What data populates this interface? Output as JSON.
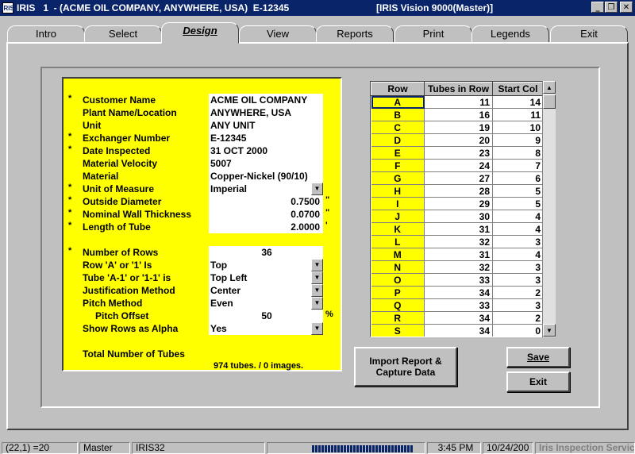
{
  "window": {
    "app_label": "IRIS",
    "title": "IRIS   1  - (ACME OIL COMPANY, ANYWHERE, USA)  E-12345",
    "title_right": "[IRIS Vision 9000(Master)]",
    "minimize": "_",
    "restore": "❐",
    "close": "✕"
  },
  "tabs": [
    "Intro",
    "Select",
    "Design",
    "View",
    "Reports",
    "Print",
    "Legends",
    "Exit"
  ],
  "active_tab": "Design",
  "form": {
    "fields": [
      {
        "required": true,
        "label": "Customer Name",
        "value": "ACME OIL COMPANY"
      },
      {
        "required": false,
        "label": "Plant Name/Location",
        "value": "ANYWHERE, USA"
      },
      {
        "required": false,
        "label": "Unit",
        "value": "ANY UNIT"
      },
      {
        "required": true,
        "label": "Exchanger Number",
        "value": "E-12345"
      },
      {
        "required": true,
        "label": "Date Inspected",
        "value": "31 OCT 2000"
      },
      {
        "required": false,
        "label": "Material Velocity",
        "value": "5007"
      },
      {
        "required": false,
        "label": "Material",
        "value": "Copper-Nickel (90/10)"
      },
      {
        "required": true,
        "label": "Unit of Measure",
        "value": "Imperial",
        "dropdown": true
      },
      {
        "required": true,
        "label": "Outside Diameter",
        "value": "0.7500",
        "unit": "\"",
        "numeric": true
      },
      {
        "required": true,
        "label": "Nominal Wall Thickness",
        "value": "0.0700",
        "unit": "\"",
        "numeric": true
      },
      {
        "required": true,
        "label": "Length of Tube",
        "value": "2.0000",
        "unit": "'",
        "numeric": true
      }
    ],
    "fields2": [
      {
        "required": true,
        "label": "Number of Rows",
        "value": "36",
        "center": true
      },
      {
        "required": false,
        "label": "Row 'A' or '1'  Is",
        "value": "Top",
        "dropdown": true
      },
      {
        "required": false,
        "label": "Tube 'A-1' or '1-1' is",
        "value": "Top Left",
        "dropdown": true
      },
      {
        "required": false,
        "label": "Justification Method",
        "value": "Center",
        "dropdown": true
      },
      {
        "required": false,
        "label": "Pitch Method",
        "value": "Even",
        "dropdown": true
      },
      {
        "required": false,
        "label": "Pitch Offset",
        "value": "50",
        "unit": "%",
        "center": true,
        "indent": true
      },
      {
        "required": false,
        "label": "Show Rows as Alpha",
        "value": "Yes",
        "dropdown": true
      }
    ],
    "total_label": "Total Number of Tubes",
    "total_value": "974 tubes. / 0 images."
  },
  "grid": {
    "headers": [
      "Row",
      "Tubes in Row",
      "Start Col"
    ],
    "rows": [
      [
        "A",
        "11",
        "14"
      ],
      [
        "B",
        "16",
        "11"
      ],
      [
        "C",
        "19",
        "10"
      ],
      [
        "D",
        "20",
        "9"
      ],
      [
        "E",
        "23",
        "8"
      ],
      [
        "F",
        "24",
        "7"
      ],
      [
        "G",
        "27",
        "6"
      ],
      [
        "H",
        "28",
        "5"
      ],
      [
        "I",
        "29",
        "5"
      ],
      [
        "J",
        "30",
        "4"
      ],
      [
        "K",
        "31",
        "4"
      ],
      [
        "L",
        "32",
        "3"
      ],
      [
        "M",
        "31",
        "4"
      ],
      [
        "N",
        "32",
        "3"
      ],
      [
        "O",
        "33",
        "3"
      ],
      [
        "P",
        "34",
        "2"
      ],
      [
        "Q",
        "33",
        "3"
      ],
      [
        "R",
        "34",
        "2"
      ],
      [
        "S",
        "34",
        "0"
      ]
    ]
  },
  "buttons": {
    "import": "Import Report &\nCapture Data",
    "save": "Save",
    "exit": "Exit"
  },
  "status": {
    "coords": "(22,1) =20",
    "mode": "Master",
    "db": "IRIS32",
    "time": "3:45 PM",
    "date": "10/24/200",
    "company": "Iris Inspection Servic"
  }
}
